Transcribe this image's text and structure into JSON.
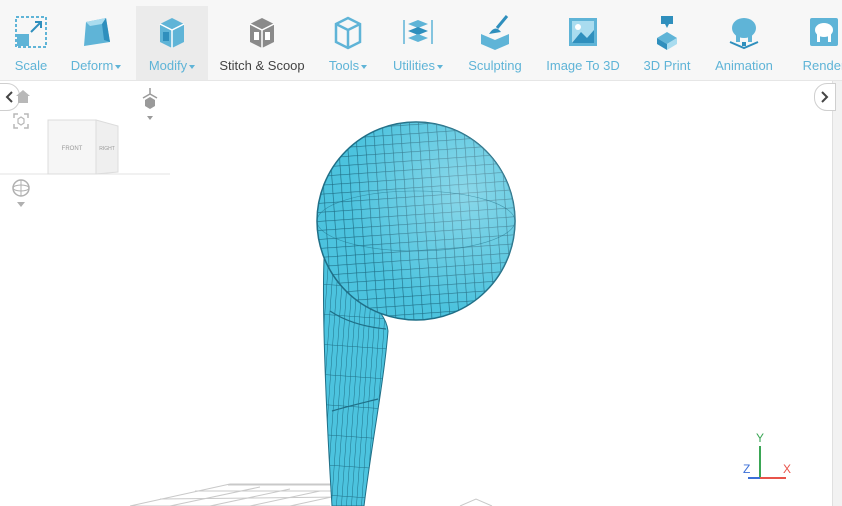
{
  "toolbar": {
    "items": [
      {
        "label": "Scale",
        "icon": "scale-icon",
        "dropdown": false
      },
      {
        "label": "Deform",
        "icon": "deform-icon",
        "dropdown": true
      },
      {
        "label": "Modify",
        "icon": "modify-icon",
        "dropdown": true,
        "active": true
      },
      {
        "label": "Stitch & Scoop",
        "icon": "stitch-scoop-icon",
        "dropdown": false
      },
      {
        "label": "Tools",
        "icon": "tools-icon",
        "dropdown": true
      },
      {
        "label": "Utilities",
        "icon": "utilities-icon",
        "dropdown": true
      },
      {
        "label": "Sculpting",
        "icon": "sculpting-icon",
        "dropdown": false
      },
      {
        "label": "Image To 3D",
        "icon": "image-to-3d-icon",
        "dropdown": false
      },
      {
        "label": "3D Print",
        "icon": "3d-print-icon",
        "dropdown": false
      },
      {
        "label": "Animation",
        "icon": "animation-icon",
        "dropdown": false
      },
      {
        "label": "Render",
        "icon": "render-icon",
        "dropdown": false
      }
    ]
  },
  "viewcube": {
    "front_label": "FRONT",
    "side_label": "RIGHT"
  },
  "axes": {
    "x": "X",
    "y": "Y",
    "z": "Z"
  },
  "colors": {
    "accent": "#5fb4d7",
    "model": "#4cc3de",
    "axis_x": "#e8534a",
    "axis_y": "#3aa655",
    "axis_z": "#3b6fd8"
  }
}
